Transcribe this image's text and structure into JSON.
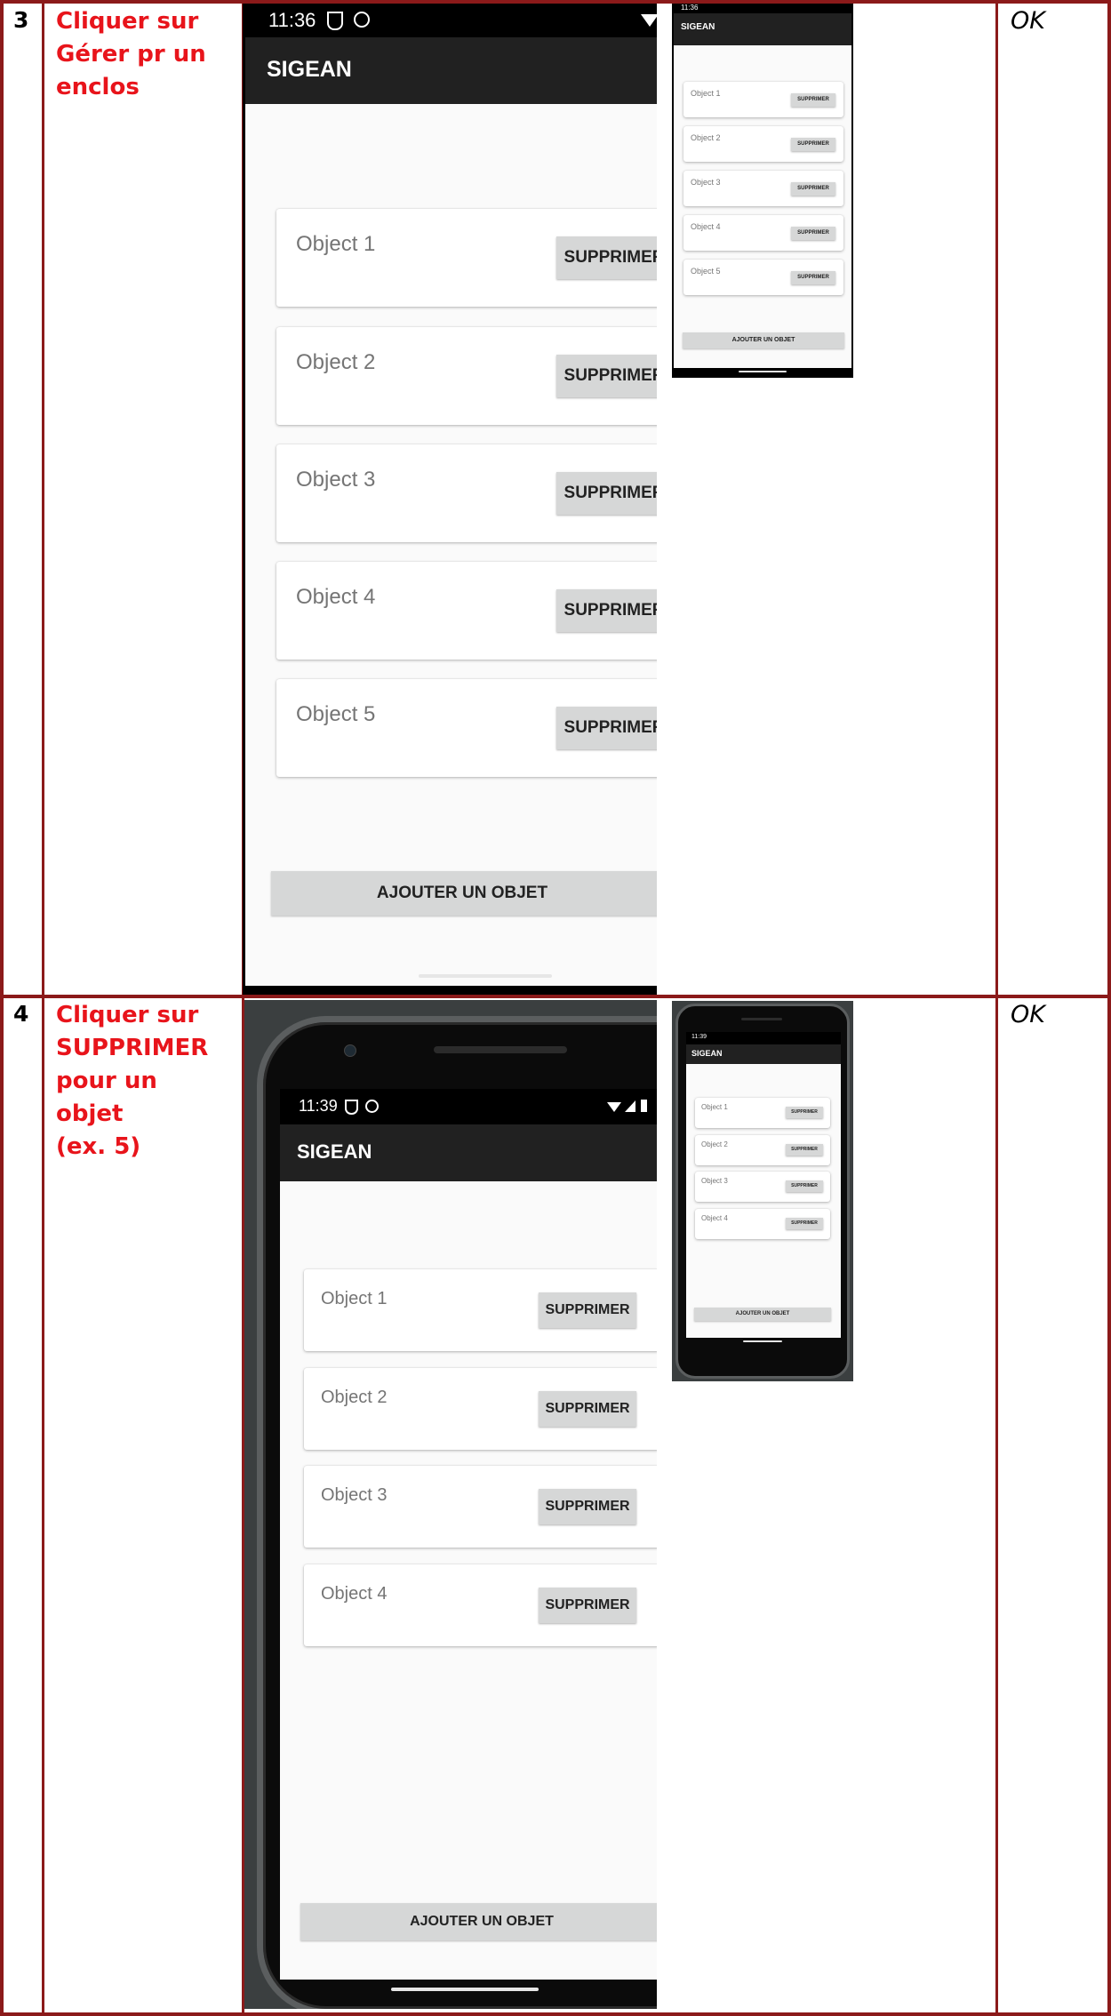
{
  "rows": [
    {
      "number": "3",
      "step_lines": [
        "Cliquer sur",
        "Gérer pr un",
        "enclos"
      ],
      "result": "OK",
      "screen": {
        "time": "11:36",
        "app_title": "SIGEAN",
        "items": [
          {
            "label": "Object 1",
            "button": "SUPPRIMER"
          },
          {
            "label": "Object 2",
            "button": "SUPPRIMER"
          },
          {
            "label": "Object 3",
            "button": "SUPPRIMER"
          },
          {
            "label": "Object 4",
            "button": "SUPPRIMER"
          },
          {
            "label": "Object 5",
            "button": "SUPPRIMER"
          }
        ],
        "add_button": "AJOUTER UN OBJET"
      }
    },
    {
      "number": "4",
      "step_lines": [
        "Cliquer sur",
        "SUPPRIMER",
        "pour un objet",
        "(ex. 5)"
      ],
      "result": "OK",
      "screen": {
        "time": "11:39",
        "app_title": "SIGEAN",
        "items": [
          {
            "label": "Object 1",
            "button": "SUPPRIMER"
          },
          {
            "label": "Object 2",
            "button": "SUPPRIMER"
          },
          {
            "label": "Object 3",
            "button": "SUPPRIMER"
          },
          {
            "label": "Object 4",
            "button": "SUPPRIMER"
          }
        ],
        "add_button": "AJOUTER UN OBJET"
      }
    }
  ],
  "colors": {
    "table_border": "#8b1a1a",
    "step_text": "#e8141b",
    "app_bar": "#212121",
    "button": "#d6d7d7"
  }
}
